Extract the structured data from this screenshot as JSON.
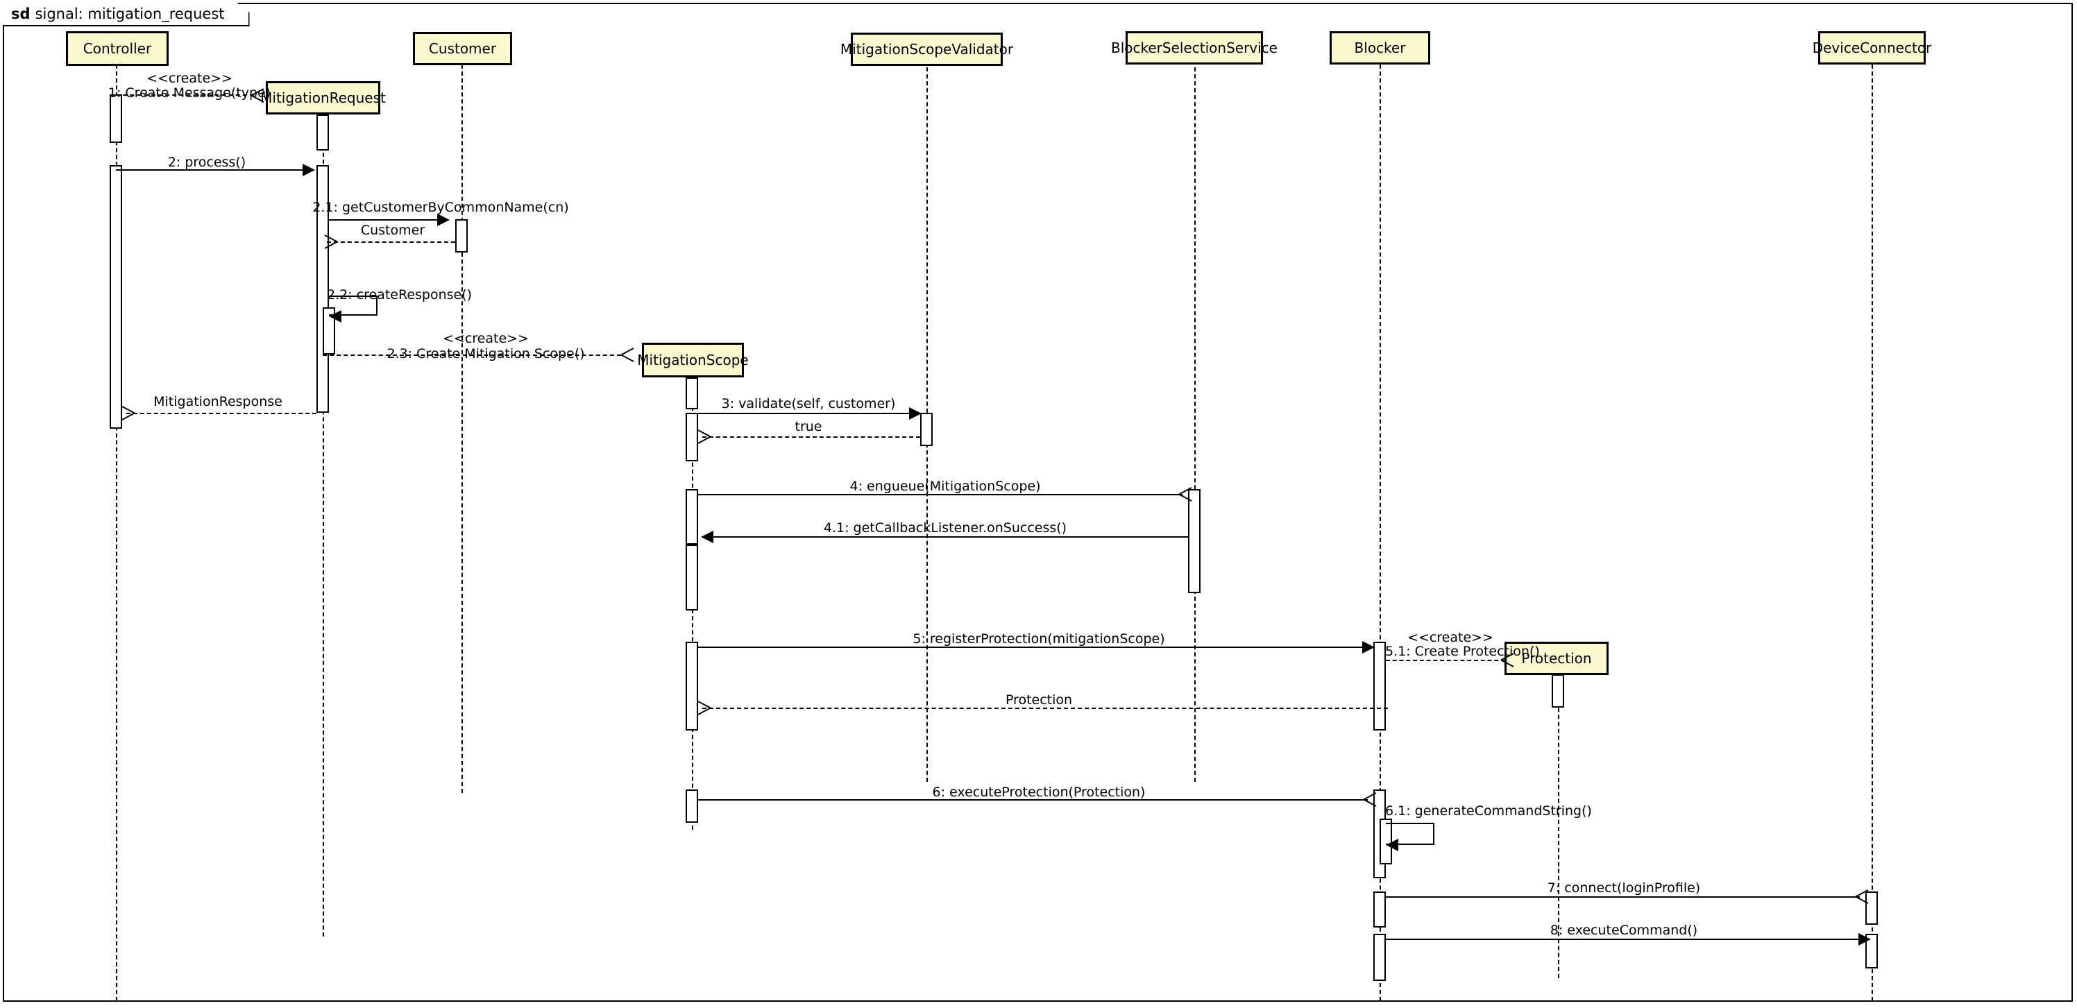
{
  "frame": {
    "keyword": "sd",
    "title": "signal: mitigation_request"
  },
  "colors": {
    "lifeline_head_fill": "#fbf9d0",
    "stroke": "#000000",
    "background": "#ffffff"
  },
  "lifelines": [
    {
      "id": "controller",
      "label": "Controller",
      "created_inline": false
    },
    {
      "id": "mitigation_request",
      "label": "MitigationRequest",
      "created_inline": true
    },
    {
      "id": "customer",
      "label": "Customer",
      "created_inline": false
    },
    {
      "id": "mitigation_scope",
      "label": "MitigationScope",
      "created_inline": true
    },
    {
      "id": "mitigation_scope_validator",
      "label": "MitigationScopeValidator",
      "created_inline": false
    },
    {
      "id": "blocker_selection_service",
      "label": "BlockerSelectionService",
      "created_inline": false
    },
    {
      "id": "blocker",
      "label": "Blocker",
      "created_inline": false
    },
    {
      "id": "protection",
      "label": "Protection",
      "created_inline": true
    },
    {
      "id": "device_connector",
      "label": "DeviceConnector",
      "created_inline": false
    }
  ],
  "messages": [
    {
      "seq": "1",
      "label": "1: Create Message(type)",
      "stereotype": "<<create>>",
      "from": "controller",
      "to": "mitigation_request",
      "kind": "create"
    },
    {
      "seq": "2",
      "label": "2: process()",
      "stereotype": "",
      "from": "controller",
      "to": "mitigation_request",
      "kind": "call"
    },
    {
      "seq": "2.1",
      "label": "2.1: getCustomerByCommonName(cn)",
      "stereotype": "",
      "from": "mitigation_request",
      "to": "customer",
      "kind": "call"
    },
    {
      "seq": "2.1r",
      "label": "Customer",
      "stereotype": "",
      "from": "customer",
      "to": "mitigation_request",
      "kind": "return"
    },
    {
      "seq": "2.2",
      "label": "2.2: createResponse()",
      "stereotype": "",
      "from": "mitigation_request",
      "to": "mitigation_request",
      "kind": "self"
    },
    {
      "seq": "2.3",
      "label": "2.3: Create Mitigation Scope()",
      "stereotype": "<<create>>",
      "from": "mitigation_request",
      "to": "mitigation_scope",
      "kind": "create"
    },
    {
      "seq": "2r",
      "label": "MitigationResponse",
      "stereotype": "",
      "from": "mitigation_request",
      "to": "controller",
      "kind": "return"
    },
    {
      "seq": "3",
      "label": "3: validate(self, customer)",
      "stereotype": "",
      "from": "mitigation_scope",
      "to": "mitigation_scope_validator",
      "kind": "call"
    },
    {
      "seq": "3r",
      "label": "true",
      "stereotype": "",
      "from": "mitigation_scope_validator",
      "to": "mitigation_scope",
      "kind": "return"
    },
    {
      "seq": "4",
      "label": "4: engueue(MitigationScope)",
      "stereotype": "",
      "from": "mitigation_scope",
      "to": "blocker_selection_service",
      "kind": "async"
    },
    {
      "seq": "4.1",
      "label": "4.1: getCallbackListener.onSuccess()",
      "stereotype": "",
      "from": "blocker_selection_service",
      "to": "mitigation_scope",
      "kind": "call"
    },
    {
      "seq": "5",
      "label": "5: registerProtection(mitigationScope)",
      "stereotype": "",
      "from": "mitigation_scope",
      "to": "blocker",
      "kind": "call"
    },
    {
      "seq": "5.1",
      "label": "5.1: Create Protection()",
      "stereotype": "<<create>>",
      "from": "blocker",
      "to": "protection",
      "kind": "create"
    },
    {
      "seq": "5r",
      "label": "Protection",
      "stereotype": "",
      "from": "blocker",
      "to": "mitigation_scope",
      "kind": "return"
    },
    {
      "seq": "6",
      "label": "6: executeProtection(Protection)",
      "stereotype": "",
      "from": "mitigation_scope",
      "to": "blocker",
      "kind": "async"
    },
    {
      "seq": "6.1",
      "label": "6.1: generateCommandString()",
      "stereotype": "",
      "from": "blocker",
      "to": "blocker",
      "kind": "self"
    },
    {
      "seq": "7",
      "label": "7: connect(loginProfile)",
      "stereotype": "",
      "from": "blocker",
      "to": "device_connector",
      "kind": "async"
    },
    {
      "seq": "8",
      "label": "8: executeCommand()",
      "stereotype": "",
      "from": "blocker",
      "to": "device_connector",
      "kind": "call"
    }
  ]
}
